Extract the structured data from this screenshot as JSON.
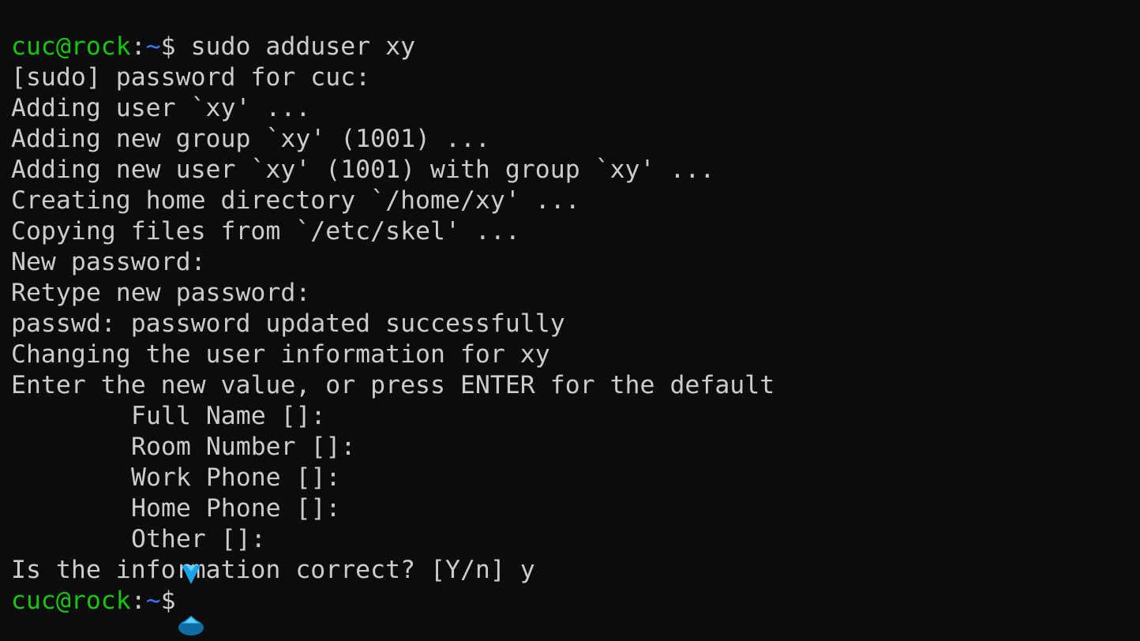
{
  "prompt": {
    "user_host": "cuc@rock",
    "colon": ":",
    "path": "~",
    "symbol": "$ "
  },
  "command": "sudo adduser xy",
  "output_lines": [
    "[sudo] password for cuc:",
    "Adding user `xy' ...",
    "Adding new group `xy' (1001) ...",
    "Adding new user `xy' (1001) with group `xy' ...",
    "Creating home directory `/home/xy' ...",
    "Copying files from `/etc/skel' ...",
    "New password:",
    "Retype new password:",
    "passwd: password updated successfully",
    "Changing the user information for xy",
    "Enter the new value, or press ENTER for the default"
  ],
  "indented_lines": [
    "Full Name []:",
    "Room Number []:",
    "Work Phone []:",
    "Home Phone []:",
    "Other []:"
  ],
  "confirm_line": "Is the information correct? [Y/n] y",
  "colors": {
    "background": "#0c0c0c",
    "text": "#cccccc",
    "prompt_user": "#16c60c",
    "prompt_path": "#3b78ff",
    "selection_handle": "#1aa3e8"
  },
  "icons": {
    "selection_start": "text-selection-handle-icon",
    "selection_end": "text-selection-handle-icon"
  }
}
